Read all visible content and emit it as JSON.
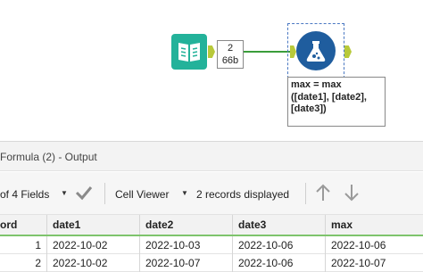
{
  "workflow": {
    "input_tool_icon": "book-input-icon",
    "record_count": "2",
    "data_size": "66b",
    "formula_tool_icon": "formula-flask-icon",
    "annotation_lines": [
      "max = max",
      "([date1], [date2],",
      "[date3])"
    ],
    "connection_color": "#3a9d3a",
    "input_tool_color": "#23b29a",
    "formula_tool_color": "#1f5d9e",
    "anchor_color": "#b8c93a"
  },
  "results": {
    "panel_title": "Formula (2) - Output",
    "fields_selector": "of 4 Fields",
    "fields_caret_icon": "caret-down-icon",
    "apply_icon": "checkmark-icon",
    "cell_viewer_label": "Cell Viewer",
    "cell_viewer_caret_icon": "caret-down-icon",
    "records_status": "2 records displayed",
    "scroll_up_icon": "arrow-up-icon",
    "scroll_down_icon": "arrow-down-icon",
    "columns": [
      "ord",
      "date1",
      "date2",
      "date3",
      "max"
    ],
    "rows": [
      {
        "record": "1",
        "date1": "2022-10-02",
        "date2": "2022-10-03",
        "date3": "2022-10-06",
        "max": "2022-10-06"
      },
      {
        "record": "2",
        "date1": "2022-10-02",
        "date2": "2022-10-07",
        "date3": "2022-10-06",
        "max": "2022-10-07"
      }
    ],
    "header_accent_color": "#7ec46c"
  }
}
